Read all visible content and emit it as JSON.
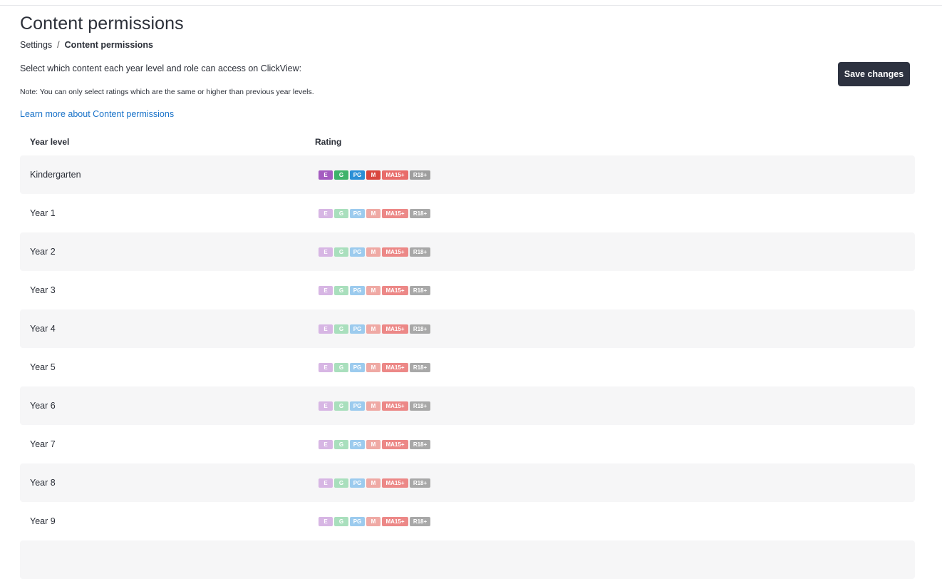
{
  "page": {
    "title": "Content permissions",
    "breadcrumb": {
      "parent": "Settings",
      "separator": "/",
      "current": "Content permissions"
    },
    "intro": "Select which content each year level and role can access on ClickView:",
    "note": "Note: You can only select ratings which are the same or higher than previous year levels.",
    "learn_link": "Learn more about Content permissions",
    "save_label": "Save changes"
  },
  "table": {
    "columns": [
      "Year level",
      "Rating"
    ],
    "ratings": [
      {
        "label": "E",
        "color_active": "#a45cc0",
        "color_inactive": "#d7b6e4"
      },
      {
        "label": "G",
        "color_active": "#3fb36b",
        "color_inactive": "#a9dfbd"
      },
      {
        "label": "PG",
        "color_active": "#2b8fd6",
        "color_inactive": "#9ccbee"
      },
      {
        "label": "M",
        "color_active": "#d9463e",
        "color_inactive": "#efa9a4"
      },
      {
        "label": "MA15+",
        "color_active": "#e86c6a",
        "color_inactive": "#ec8887"
      },
      {
        "label": "R18+",
        "color_active": "#9e9e9e",
        "color_inactive": "#a8a8a8"
      }
    ],
    "rows": [
      {
        "year": "Kindergarten",
        "active": true
      },
      {
        "year": "Year 1",
        "active": false
      },
      {
        "year": "Year 2",
        "active": false
      },
      {
        "year": "Year 3",
        "active": false
      },
      {
        "year": "Year 4",
        "active": false
      },
      {
        "year": "Year 5",
        "active": false
      },
      {
        "year": "Year 6",
        "active": false
      },
      {
        "year": "Year 7",
        "active": false
      },
      {
        "year": "Year 8",
        "active": false
      },
      {
        "year": "Year 9",
        "active": false
      },
      {
        "year": "",
        "active": false
      }
    ]
  }
}
